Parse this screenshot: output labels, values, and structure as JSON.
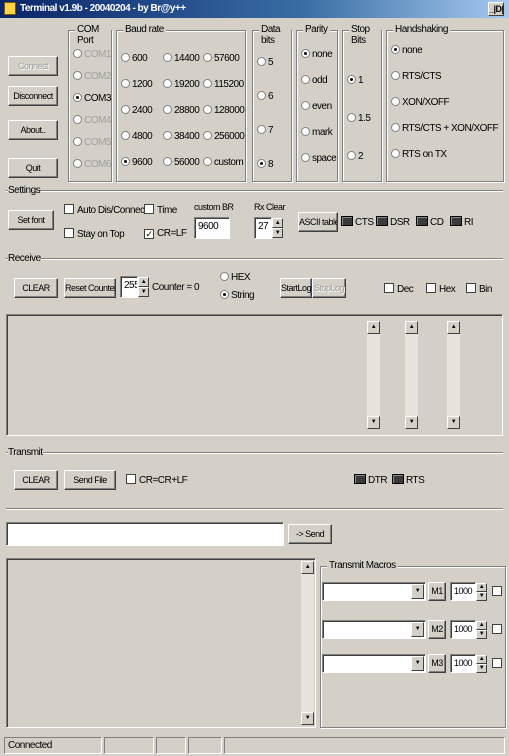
{
  "window": {
    "title": "Terminal v1.9b - 20040204 - by Br@y++",
    "control_label": "_|D|"
  },
  "com_port": {
    "label": "COM Port",
    "ports": [
      "COM1",
      "COM2",
      "COM3",
      "COM4",
      "COM5",
      "COM6"
    ],
    "selected": "COM3"
  },
  "buttons": {
    "connect": "Connect",
    "disconnect": "Disconnect",
    "about": "About..",
    "quit": "Quit"
  },
  "baud": {
    "label": "Baud rate",
    "options": [
      "600",
      "1200",
      "2400",
      "4800",
      "9600",
      "14400",
      "19200",
      "28800",
      "38400",
      "56000",
      "57600",
      "115200",
      "128000",
      "256000",
      "custom"
    ],
    "selected": "9600"
  },
  "data_bits": {
    "label": "Data bits",
    "options": [
      "5",
      "6",
      "7",
      "8"
    ],
    "selected": "8"
  },
  "parity": {
    "label": "Parity",
    "options": [
      "none",
      "odd",
      "even",
      "mark",
      "space"
    ],
    "selected": "none"
  },
  "stop_bits": {
    "label": "Stop Bits",
    "options": [
      "1",
      "1.5",
      "2"
    ],
    "selected": "1"
  },
  "handshaking": {
    "label": "Handshaking",
    "options": [
      "none",
      "RTS/CTS",
      "XON/XOFF",
      "RTS/CTS + XON/XOFF",
      "RTS on TX"
    ],
    "selected": "none"
  },
  "settings": {
    "label": "Settings",
    "set_font": "Set font",
    "auto_dis_connect": "Auto Dis/Connect",
    "stay_on_top": "Stay on Top",
    "time": "Time",
    "cr_lf": "CR=LF",
    "custom_br_label": "custom BR",
    "custom_br_value": "9600",
    "rx_clear_label": "Rx Clear",
    "rx_clear_value": "27",
    "ascii_table": "ASCII table",
    "signals": [
      "CTS",
      "DSR",
      "CD",
      "RI"
    ]
  },
  "receive": {
    "label": "Receive",
    "clear": "CLEAR",
    "reset_counter": "Reset Counter",
    "counter_spin": "255",
    "counter_text": "Counter = 0",
    "modes": [
      "HEX",
      "String"
    ],
    "mode_selected": "String",
    "start_log": "StartLog",
    "stop_log": "StopLog",
    "views": [
      "Dec",
      "Hex",
      "Bin"
    ]
  },
  "transmit": {
    "label": "Transmit",
    "clear": "CLEAR",
    "send_file": "Send File",
    "cr_option": "CR=CR+LF",
    "signals": [
      "DTR",
      "RTS"
    ],
    "input_value": "",
    "send": "-> Send"
  },
  "macros": {
    "label": "Transmit Macros",
    "items": [
      {
        "btn": "M1",
        "interval": "1000"
      },
      {
        "btn": "M2",
        "interval": "1000"
      },
      {
        "btn": "M3",
        "interval": "1000"
      }
    ]
  },
  "status": {
    "text": "Connected"
  }
}
